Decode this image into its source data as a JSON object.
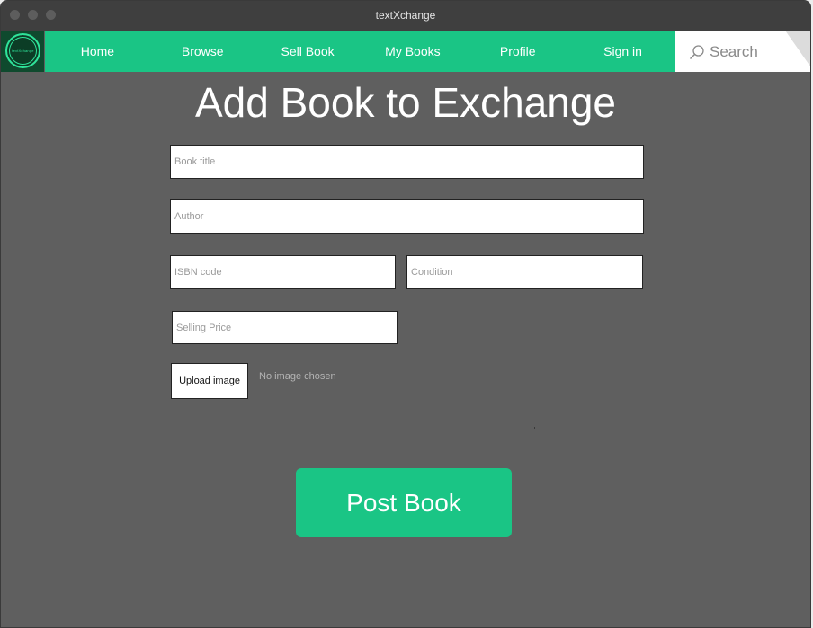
{
  "window": {
    "title": "textXchange"
  },
  "logo": {
    "text": "textXchange"
  },
  "nav": {
    "items": [
      {
        "label": "Home"
      },
      {
        "label": "Browse"
      },
      {
        "label": "Sell Book"
      },
      {
        "label": "My Books"
      },
      {
        "label": "Profile"
      },
      {
        "label": "Sign in"
      }
    ]
  },
  "search": {
    "placeholder": "Search",
    "icon": "search-icon"
  },
  "page": {
    "title": "Add Book to Exchange"
  },
  "form": {
    "book_title": {
      "placeholder": "Book title",
      "value": ""
    },
    "author": {
      "placeholder": "Author",
      "value": ""
    },
    "isbn": {
      "placeholder": "ISBN code",
      "value": ""
    },
    "condition": {
      "placeholder": "Condition",
      "value": ""
    },
    "selling_price": {
      "placeholder": "Selling Price",
      "value": ""
    },
    "upload_label": "Upload image",
    "upload_status": "No image chosen",
    "submit_label": "Post Book"
  },
  "colors": {
    "accent": "#1ac585",
    "background": "#5f5f5f",
    "titlebar": "#3f3f3f",
    "logo_bg": "#0f4a2e"
  }
}
